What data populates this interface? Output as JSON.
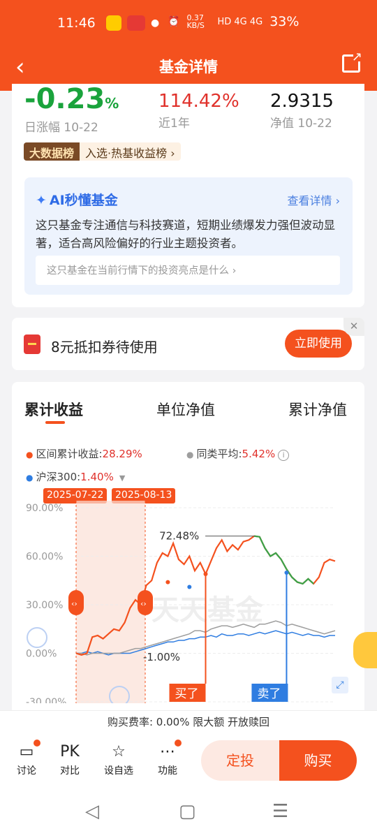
{
  "status_bar": {
    "time": "11:46",
    "speed": "0.37 KB/S",
    "signal": "HD 4G 4G",
    "battery": "33%"
  },
  "header": {
    "title": "基金详情"
  },
  "metrics": [
    {
      "value": "-0.23",
      "unit": "%",
      "label": "日涨幅 10-22"
    },
    {
      "value": "114.42%",
      "label": "近1年"
    },
    {
      "value": "2.9315",
      "label": "净值 10-22"
    }
  ],
  "badge": {
    "tag": "大数据榜",
    "text": "入选·热基收益榜 ›"
  },
  "ai": {
    "title": "AI秒懂基金",
    "more": "查看详情 ›",
    "desc": "这只基金专注通信与科技赛道，短期业绩爆发力强但波动显著，适合高风险偏好的行业主题投资者。",
    "query": "这只基金在当前行情下的投资亮点是什么 ›"
  },
  "coupon": {
    "text": "8元抵扣券待使用",
    "button": "立即使用",
    "close": "✕"
  },
  "chart_tabs": [
    "累计收益",
    "单位净值",
    "累计净值"
  ],
  "legend": {
    "range_label": "区间累计收益:",
    "range_value": "28.29%",
    "peer_label": "同类平均:",
    "peer_value": "5.42%",
    "index_label": "沪深300:",
    "index_value": "1.40%"
  },
  "date_tags": [
    "2025-07-22",
    "2025-08-13"
  ],
  "watermark": "天天基金",
  "chart_data": {
    "type": "line",
    "ylim": [
      -30,
      90
    ],
    "yticks": [
      "90.00%",
      "60.00%",
      "30.00%",
      "0.00%",
      "-30.00%"
    ],
    "series": [
      {
        "name": "区间累计收益",
        "color": "#f4511e",
        "values": [
          0,
          -1,
          0,
          10,
          11,
          9,
          12,
          15,
          14,
          19,
          28,
          33,
          30,
          42,
          45,
          56,
          62,
          60,
          68,
          58,
          55,
          60,
          51,
          56,
          49,
          57,
          65,
          70,
          63,
          67,
          64,
          69,
          70,
          72.48,
          72,
          65,
          60,
          62,
          58,
          52,
          47,
          44,
          43,
          46,
          43,
          47,
          56,
          58,
          57
        ]
      },
      {
        "name": "同类平均",
        "color": "#9e9e9e",
        "values": [
          0,
          0,
          -1,
          0,
          0,
          0,
          0,
          0,
          0,
          1,
          2,
          3,
          3,
          4,
          5,
          6,
          7,
          8,
          9,
          10,
          11,
          12,
          14,
          14,
          13,
          15,
          16,
          17,
          17,
          16,
          17,
          18,
          17,
          16,
          18,
          18,
          19,
          20,
          19,
          17,
          18,
          17,
          16,
          15,
          14,
          13,
          12,
          13,
          14
        ]
      },
      {
        "name": "沪深300",
        "color": "#2f7de1",
        "values": [
          0,
          0,
          1,
          0,
          1,
          0,
          -1,
          0,
          0,
          0,
          0,
          1,
          2,
          3,
          4,
          5,
          6,
          7,
          7,
          8,
          8,
          9,
          9,
          10,
          10,
          11,
          10,
          12,
          11,
          11,
          12,
          12,
          11,
          12,
          13,
          12,
          13,
          14,
          13,
          12,
          13,
          12,
          11,
          12,
          11,
          11,
          10,
          11,
          11
        ]
      }
    ],
    "peak_label": "72.48%",
    "baseline_label": "-1.00%",
    "markers": [
      "买了",
      "卖了"
    ]
  },
  "fee": "购买费率: 0.00% 限大额 开放赎回",
  "bottom_nav": [
    {
      "label": "讨论",
      "icon": "chat-icon"
    },
    {
      "label": "对比",
      "icon": "pk-icon",
      "glyph": "PK"
    },
    {
      "label": "设自选",
      "icon": "star-icon"
    },
    {
      "label": "功能",
      "icon": "more-icon"
    }
  ],
  "actions": {
    "dingtou": "定投",
    "buy": "购买"
  }
}
